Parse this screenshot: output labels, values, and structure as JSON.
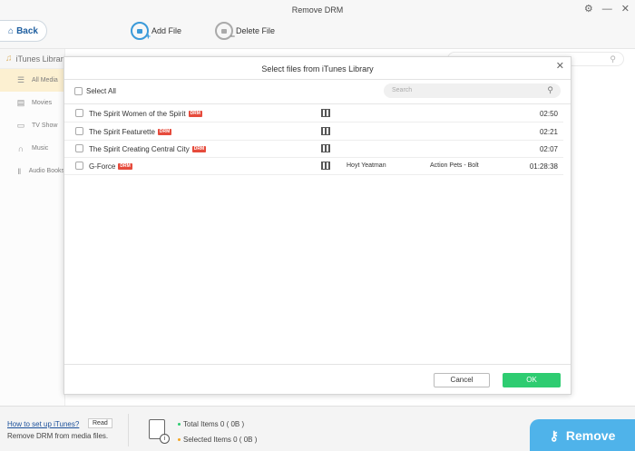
{
  "window": {
    "title": "Remove DRM",
    "settings_icon": "gear-icon",
    "minimize_symbol": "—",
    "close_symbol": "✕"
  },
  "toolbar": {
    "back_label": "Back",
    "add_file_label": "Add File",
    "delete_file_label": "Delete File"
  },
  "sidebar": {
    "header": "iTunes Library",
    "items": [
      {
        "label": "All Media",
        "icon": "media-icon",
        "glyph": "☰"
      },
      {
        "label": "Movies",
        "icon": "film-icon",
        "glyph": "▤"
      },
      {
        "label": "TV Show",
        "icon": "tv-icon",
        "glyph": "▭"
      },
      {
        "label": "Music",
        "icon": "headphones-icon",
        "glyph": "∩"
      },
      {
        "label": "Audio Books",
        "icon": "audiobook-icon",
        "glyph": "‖"
      }
    ]
  },
  "modal": {
    "title": "Select files from iTunes Library",
    "select_all": "Select All",
    "search_placeholder": "Search",
    "drm_badge": "DRM",
    "rows": [
      {
        "name": "The Spirit Women of the Spirit",
        "artist": "",
        "album": "",
        "duration": "02:50"
      },
      {
        "name": "The Spirit Featurette",
        "artist": "",
        "album": "",
        "duration": "02:21"
      },
      {
        "name": "The Spirit Creating Central City",
        "artist": "",
        "album": "",
        "duration": "02:07"
      },
      {
        "name": "G-Force",
        "artist": "Hoyt Yeatman",
        "album": "Action Pets - Bolt",
        "duration": "01:28:38"
      }
    ],
    "cancel_label": "Cancel",
    "ok_label": "OK"
  },
  "bottom": {
    "howto_link": "How to set up iTunes?",
    "read_label": "Read",
    "description": "Remove DRM from media files.",
    "total_items": "Total Items 0 ( 0B )",
    "selected_items": "Selected Items 0 ( 0B )",
    "remove_label": "Remove"
  },
  "colors": {
    "accent": "#4fb3ea",
    "ok_green": "#2ecc71",
    "drm_red": "#e64b3c",
    "active_item": "#fbe8b9",
    "total_dot": "#2ecc71",
    "selected_dot": "#f5a623"
  }
}
